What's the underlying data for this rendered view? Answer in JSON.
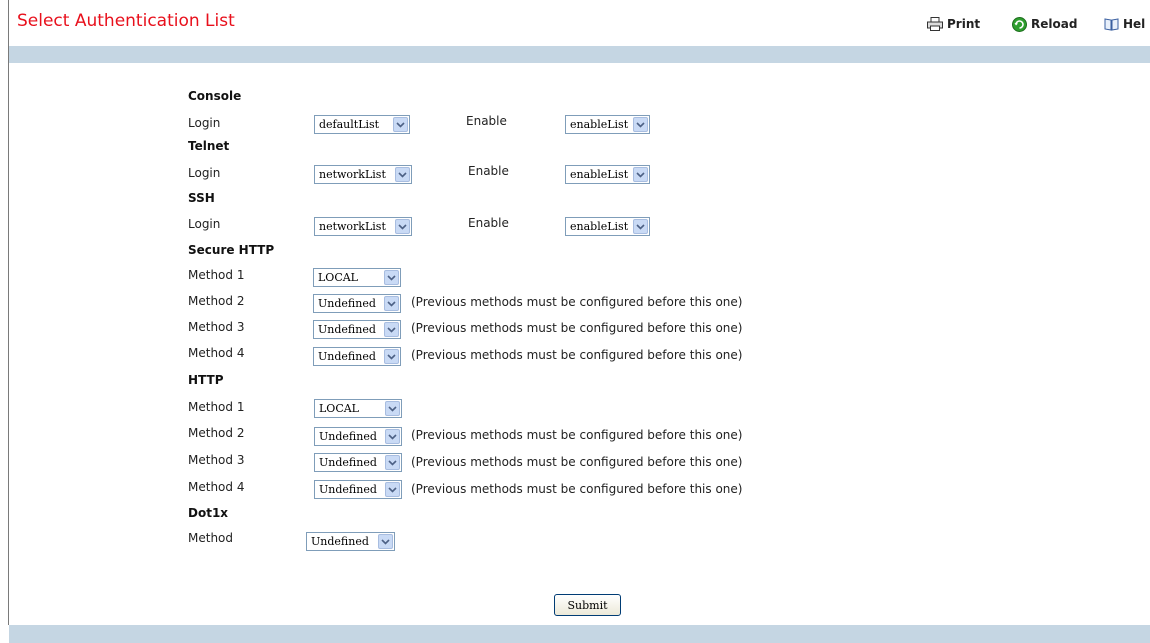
{
  "header": {
    "title": "Select Authentication List",
    "print_label": "Print",
    "reload_label": "Reload",
    "help_label": "Hel"
  },
  "console": {
    "heading": "Console",
    "login_label": "Login",
    "login_value": "defaultList",
    "enable_label": "Enable",
    "enable_value": "enableList"
  },
  "telnet": {
    "heading": "Telnet",
    "login_label": "Login",
    "login_value": "networkList",
    "enable_label": "Enable",
    "enable_value": "enableList"
  },
  "ssh": {
    "heading": "SSH",
    "login_label": "Login",
    "login_value": "networkList",
    "enable_label": "Enable",
    "enable_value": "enableList"
  },
  "secure_http": {
    "heading": "Secure HTTP",
    "methods": [
      {
        "label": "Method 1",
        "value": "LOCAL",
        "note": ""
      },
      {
        "label": "Method 2",
        "value": "Undefined",
        "note": "(Previous methods must be configured before this one)"
      },
      {
        "label": "Method 3",
        "value": "Undefined",
        "note": "(Previous methods must be configured before this one)"
      },
      {
        "label": "Method 4",
        "value": "Undefined",
        "note": "(Previous methods must be configured before this one)"
      }
    ]
  },
  "http": {
    "heading": "HTTP",
    "methods": [
      {
        "label": "Method 1",
        "value": "LOCAL",
        "note": ""
      },
      {
        "label": "Method 2",
        "value": "Undefined",
        "note": "(Previous methods must be configured before this one)"
      },
      {
        "label": "Method 3",
        "value": "Undefined",
        "note": "(Previous methods must be configured before this one)"
      },
      {
        "label": "Method 4",
        "value": "Undefined",
        "note": "(Previous methods must be configured before this one)"
      }
    ]
  },
  "dot1x": {
    "heading": "Dot1x",
    "method_label": "Method",
    "method_value": "Undefined"
  },
  "submit_label": "Submit",
  "colors": {
    "title": "#e8101c",
    "bar": "#c5d6e3",
    "select_border": "#7f9db9",
    "arrow_bg": "#c9daf5"
  },
  "icons": {
    "print": "printer-icon",
    "reload": "reload-icon",
    "help": "book-icon",
    "dropdown": "chevron-down-icon"
  }
}
